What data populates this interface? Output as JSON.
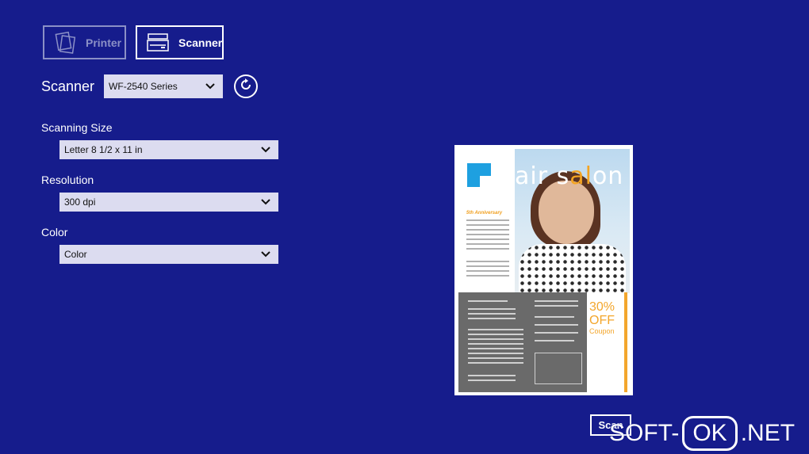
{
  "mode_tabs": {
    "printer_label": "Printer",
    "scanner_label": "Scanner"
  },
  "scanner": {
    "label": "Scanner",
    "selected": "WF-2540 Series"
  },
  "settings": {
    "size_label": "Scanning Size",
    "size_value": "Letter 8 1/2 x 11 in",
    "resolution_label": "Resolution",
    "resolution_value": "300 dpi",
    "color_label": "Color",
    "color_value": "Color"
  },
  "preview": {
    "title_part1": "hair s",
    "title_part2": "al",
    "title_part3": "on",
    "anniversary": "5th Anniversary",
    "coupon_pct": "30%",
    "coupon_off": "OFF",
    "coupon_word": "Coupon"
  },
  "scan_button_label": "Scan",
  "watermark": {
    "left": "SOFT-",
    "box": "OK",
    "right": ".NET"
  }
}
